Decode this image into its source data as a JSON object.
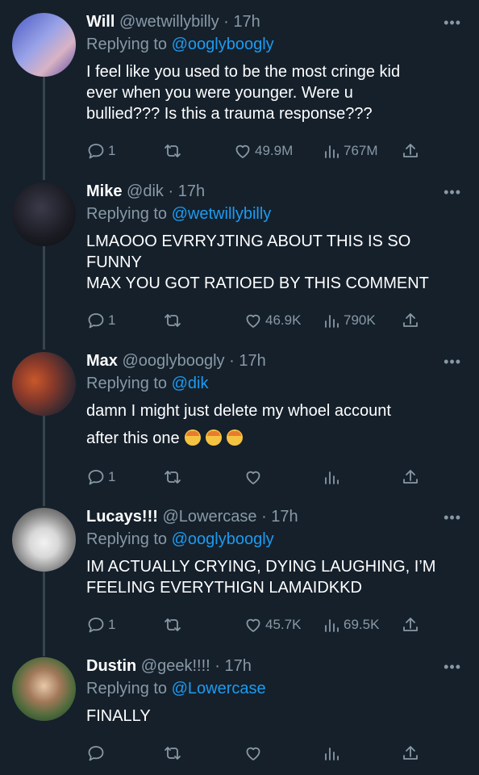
{
  "tweets": [
    {
      "name": "Will",
      "handle": "@wetwillybilly",
      "time": "17h",
      "reply_prefix": "Replying to",
      "reply_to": "@ooglyboogly",
      "lines": [
        "I feel like you used to be the most cringe kid",
        "ever when you were younger. Were u",
        "bullied??? Is this a trauma response???"
      ],
      "replies": "1",
      "likes": "49.9M",
      "views": "767M"
    },
    {
      "name": "Mike",
      "handle": "@dik",
      "time": "17h",
      "reply_prefix": "Replying to",
      "reply_to": "@wetwillybilly",
      "lines": [
        "LMAOOO EVRRYJTING ABOUT THIS IS SO",
        "FUNNY",
        "MAX YOU GOT RATIOED BY THIS COMMENT"
      ],
      "replies": "1",
      "likes": "46.9K",
      "views": "790K"
    },
    {
      "name": "Max",
      "handle": "@ooglyboogly",
      "time": "17h",
      "reply_prefix": "Replying to",
      "reply_to": "@dik",
      "lines": [
        "damn I might just delete my whoel account",
        "after this one"
      ],
      "emoji_count": 3,
      "replies": "1",
      "likes": "",
      "views": ""
    },
    {
      "name": "Lucays!!!",
      "handle": "@Lowercase",
      "time": "17h",
      "reply_prefix": "Replying to",
      "reply_to": "@ooglyboogly",
      "lines": [
        "IM ACTUALLY CRYING, DYING LAUGHING, I’M",
        "FEELING EVERYTHIGN LAMAIDKKD"
      ],
      "replies": "1",
      "likes": "45.7K",
      "views": "69.5K"
    },
    {
      "name": "Dustin",
      "handle": "@geek!!!!",
      "time": "17h",
      "reply_prefix": "Replying to",
      "reply_to": "@Lowercase",
      "lines": [
        "FINALLY"
      ],
      "replies": "",
      "likes": "",
      "views": ""
    }
  ],
  "ui": {
    "separator": "·",
    "more": "•••"
  },
  "icons": [
    "reply-icon",
    "retweet-icon",
    "like-icon",
    "views-icon",
    "share-icon",
    "more-icon"
  ],
  "colors": {
    "background": "#15202b",
    "muted": "#8899a6",
    "accent": "#1d9bf0",
    "thread_line": "#38444d"
  }
}
